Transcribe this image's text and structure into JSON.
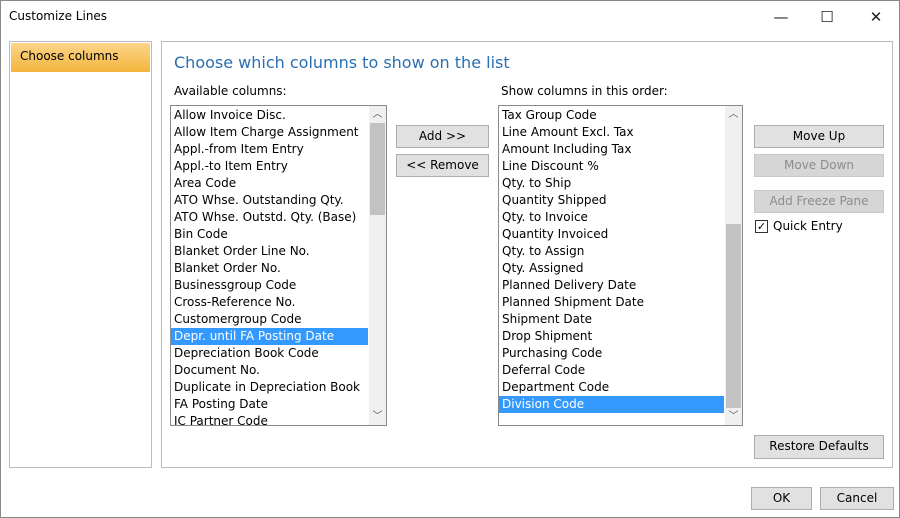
{
  "window": {
    "title": "Customize Lines",
    "minimize": "—",
    "maximize": "☐",
    "close": "✕"
  },
  "nav": {
    "items": [
      {
        "label": "Choose columns",
        "selected": true
      }
    ]
  },
  "main": {
    "heading": "Choose which columns to show on the list",
    "available_label": "Available columns:",
    "available": [
      "Allow Invoice Disc.",
      "Allow Item Charge Assignment",
      "Appl.-from Item Entry",
      "Appl.-to Item Entry",
      "Area Code",
      "ATO Whse. Outstanding Qty.",
      "ATO Whse. Outstd. Qty. (Base)",
      "Bin Code",
      "Blanket Order Line No.",
      "Blanket Order No.",
      "Businessgroup Code",
      "Cross-Reference No.",
      "Customergroup Code",
      "Depr. until FA Posting Date",
      "Depreciation Book Code",
      "Document No.",
      "Duplicate in Depreciation Book",
      "FA Posting Date",
      "IC Partner Code"
    ],
    "available_selected": "Depr. until FA Posting Date",
    "shown_label": "Show columns in this order:",
    "shown": [
      "Tax Group Code",
      "Line Amount Excl. Tax",
      "Amount Including Tax",
      "Line Discount %",
      "Qty. to Ship",
      "Quantity Shipped",
      "Qty. to Invoice",
      "Quantity Invoiced",
      "Qty. to Assign",
      "Qty. Assigned",
      "Planned Delivery Date",
      "Planned Shipment Date",
      "Shipment Date",
      "Drop Shipment",
      "Purchasing Code",
      "Deferral Code",
      "Department Code",
      "Division Code"
    ],
    "shown_selected": "Division Code",
    "add": "Add >>",
    "remove": "<< Remove",
    "move_up": "Move Up",
    "move_down": "Move Down",
    "add_freeze": "Add Freeze Pane",
    "quick_entry": "Quick Entry",
    "quick_entry_checked": true,
    "restore": "Restore Defaults"
  },
  "footer": {
    "ok": "OK",
    "cancel": "Cancel"
  }
}
